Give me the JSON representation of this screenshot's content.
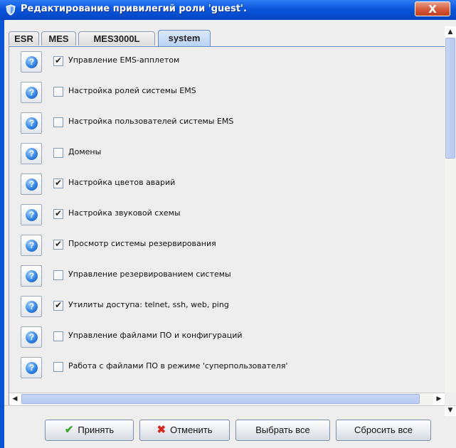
{
  "window": {
    "title": "Редактирование привилегий роли 'guest'.",
    "close_label": "X"
  },
  "tabs": [
    {
      "label": "ESR"
    },
    {
      "label": "MES"
    },
    {
      "label": "MES3000L"
    },
    {
      "label": "system"
    }
  ],
  "active_tab": "system",
  "privileges": [
    {
      "label": "Управление EMS-апплетом",
      "checked": true
    },
    {
      "label": "Настройка ролей системы EMS",
      "checked": false
    },
    {
      "label": "Настройка пользователей системы EMS",
      "checked": false
    },
    {
      "label": "Домены",
      "checked": false
    },
    {
      "label": "Настройка цветов аварий",
      "checked": true
    },
    {
      "label": "Настройка звуковой схемы",
      "checked": true
    },
    {
      "label": "Просмотр системы резервирования",
      "checked": true
    },
    {
      "label": "Управление резервированием системы",
      "checked": false
    },
    {
      "label": "Утилиты доступа: telnet, ssh, web, ping",
      "checked": true
    },
    {
      "label": "Управление файлами ПО и конфигураций",
      "checked": false
    },
    {
      "label": "Работа с файлами ПО в режиме 'суперпользователя'",
      "checked": false
    }
  ],
  "help_glyph": "?",
  "check_glyph": "✔",
  "buttons": {
    "accept": "Принять",
    "cancel": "Отменить",
    "select_all": "Выбрать все",
    "reset_all": "Сбросить все"
  },
  "colors": {
    "accept_icon": "#3aa82e",
    "cancel_icon": "#d42a1c",
    "title_bar": "#0a55d9"
  },
  "icons": {
    "accept": "check-icon",
    "cancel": "cross-icon",
    "help": "help-icon",
    "window": "shield-icon"
  }
}
